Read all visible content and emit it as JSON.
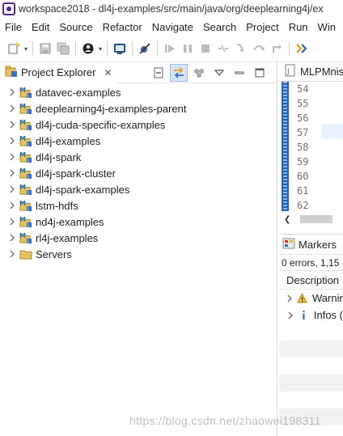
{
  "window": {
    "title": "workspace2018 - dl4j-examples/src/main/java/org/deeplearning4j/ex",
    "icon": "eclipse-icon"
  },
  "menubar": {
    "items": [
      "File",
      "Edit",
      "Source",
      "Refactor",
      "Navigate",
      "Search",
      "Project",
      "Run",
      "Win"
    ]
  },
  "toolbar": {
    "buttons": [
      "new-icon",
      "save-icon",
      "save-all-icon",
      "debug-profile-icon",
      "console-icon",
      "skip-breakpoints-icon",
      "resume-icon",
      "suspend-icon",
      "terminate-icon",
      "step-into-icon",
      "step-over-icon",
      "step-return-icon",
      "drop-to-frame-icon",
      "open-type-icon"
    ]
  },
  "project_explorer": {
    "tab_label": "Project Explorer",
    "tab_close": "✕",
    "projects": [
      {
        "label": "datavec-examples",
        "type": "maven-project"
      },
      {
        "label": "deeplearning4j-examples-parent",
        "type": "maven-project"
      },
      {
        "label": "dl4j-cuda-specific-examples",
        "type": "maven-project"
      },
      {
        "label": "dl4j-examples",
        "type": "maven-project"
      },
      {
        "label": "dl4j-spark",
        "type": "maven-project"
      },
      {
        "label": "dl4j-spark-cluster",
        "type": "maven-project"
      },
      {
        "label": "dl4j-spark-examples",
        "type": "maven-project"
      },
      {
        "label": "lstm-hdfs",
        "type": "maven-project"
      },
      {
        "label": "nd4j-examples",
        "type": "maven-project"
      },
      {
        "label": "rl4j-examples",
        "type": "maven-project"
      },
      {
        "label": "Servers",
        "type": "folder"
      }
    ]
  },
  "editor": {
    "tab_label": "MLPMnist",
    "line_numbers": [
      "54",
      "55",
      "56",
      "57",
      "58",
      "59",
      "60",
      "61",
      "62"
    ]
  },
  "markers": {
    "tab_label": "Markers",
    "summary": "0 errors, 1,15",
    "column_header": "Description",
    "rows": [
      {
        "label": "Warnin",
        "icon": "warning-icon"
      },
      {
        "label": "Infos (",
        "icon": "info-icon"
      }
    ]
  },
  "watermark": "https://blog.csdn.net/zhaowei198311",
  "colors": {
    "folder_yellow": "#e8c25a",
    "maven_blue": "#2d6fc1",
    "selection_blue": "#d4e3f5",
    "gutter_blue": "#1e63b8"
  }
}
